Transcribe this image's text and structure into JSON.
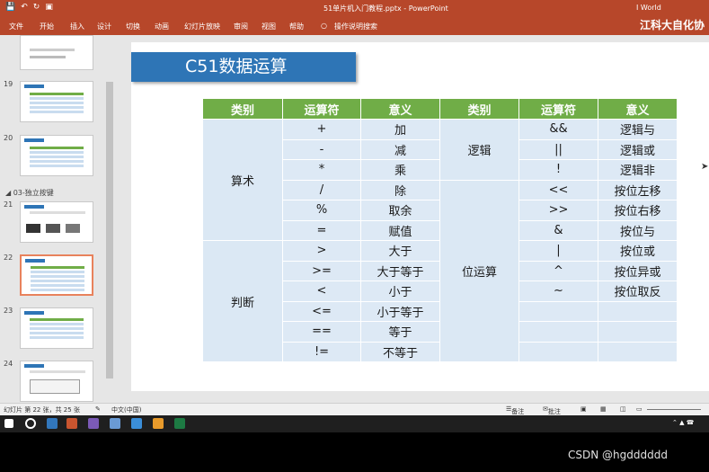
{
  "window": {
    "title": "51单片机入门教程.pptx - PowerPoint",
    "user": "I World",
    "brand": "江科大自化协"
  },
  "qat_icons": [
    "save-icon",
    "undo-icon",
    "redo-icon",
    "present-icon"
  ],
  "ribbon": {
    "tabs": [
      "文件",
      "开始",
      "插入",
      "设计",
      "切换",
      "动画",
      "幻灯片放映",
      "审阅",
      "视图",
      "帮助"
    ],
    "tell_me": "操作说明搜索"
  },
  "thumbnails": {
    "items": [
      {
        "num": "19"
      },
      {
        "num": "20"
      },
      {
        "num": "21"
      },
      {
        "num": "22"
      },
      {
        "num": "23"
      },
      {
        "num": "24"
      }
    ],
    "section": "03-独立按键"
  },
  "slide": {
    "title": "C51数据运算",
    "headers": [
      "类别",
      "运算符",
      "意义",
      "类别",
      "运算符",
      "意义"
    ],
    "left": {
      "group1": "算术",
      "group2": "判断",
      "rows": [
        {
          "op": "+",
          "meaning": "加"
        },
        {
          "op": "-",
          "meaning": "减"
        },
        {
          "op": "*",
          "meaning": "乘"
        },
        {
          "op": "/",
          "meaning": "除"
        },
        {
          "op": "%",
          "meaning": "取余"
        },
        {
          "op": "=",
          "meaning": "赋值"
        },
        {
          "op": ">",
          "meaning": "大于"
        },
        {
          "op": ">=",
          "meaning": "大于等于"
        },
        {
          "op": "<",
          "meaning": "小于"
        },
        {
          "op": "<=",
          "meaning": "小于等于"
        },
        {
          "op": "==",
          "meaning": "等于"
        },
        {
          "op": "!=",
          "meaning": "不等于"
        }
      ]
    },
    "right": {
      "group1": "逻辑",
      "group2": "位运算",
      "rows": [
        {
          "op": "&&",
          "meaning": "逻辑与"
        },
        {
          "op": "||",
          "meaning": "逻辑或"
        },
        {
          "op": "!",
          "meaning": "逻辑非"
        },
        {
          "op": "<<",
          "meaning": "按位左移"
        },
        {
          "op": ">>",
          "meaning": "按位右移"
        },
        {
          "op": "&",
          "meaning": "按位与"
        },
        {
          "op": "|",
          "meaning": "按位或"
        },
        {
          "op": "^",
          "meaning": "按位异或"
        },
        {
          "op": "~",
          "meaning": "按位取反"
        },
        {
          "op": "",
          "meaning": ""
        },
        {
          "op": "",
          "meaning": ""
        },
        {
          "op": "",
          "meaning": ""
        }
      ]
    }
  },
  "status": {
    "slide_info": "幻灯片 第 22 张，共 25 张",
    "language": "中文(中国)",
    "notes": "备注",
    "comments": "批注"
  },
  "watermark": "CSDN @hgdddddd",
  "colors": {
    "ribbon": "#b7472a",
    "title_bg": "#2e75b6",
    "header_bg": "#70ad47",
    "cell_bg": "#dde9f5"
  }
}
